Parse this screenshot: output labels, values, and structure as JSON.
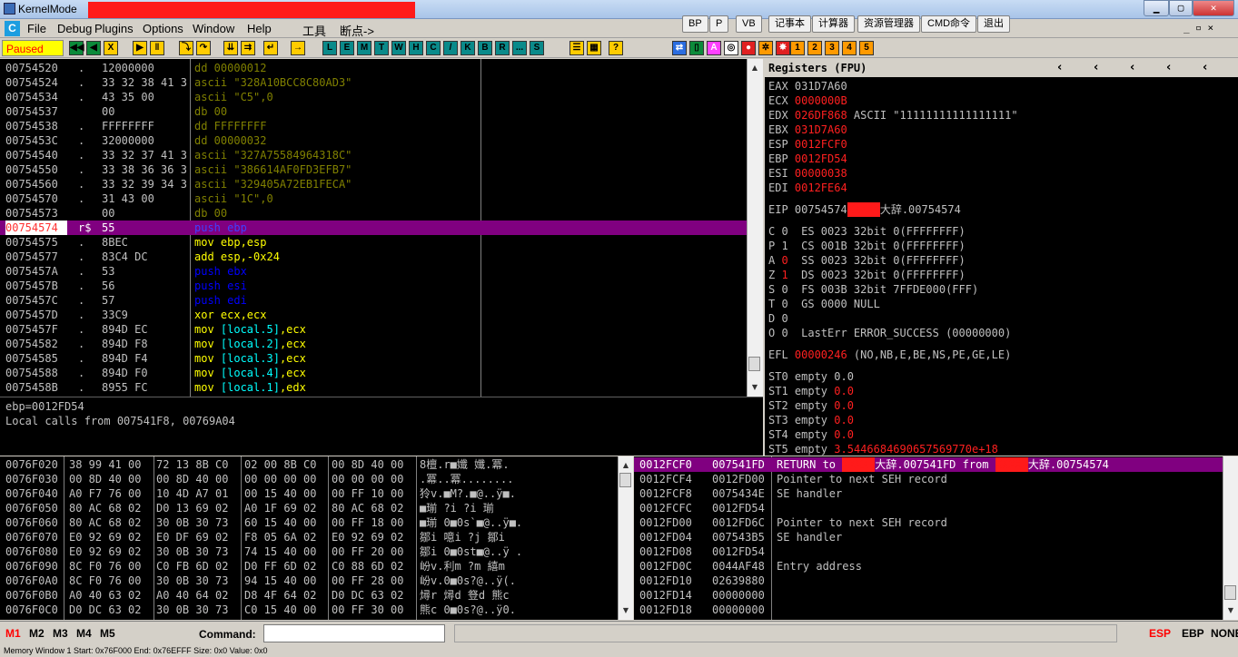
{
  "window": {
    "title": "KernelMode"
  },
  "menu": [
    "File",
    "Debug",
    "Plugins",
    "Options",
    "Window",
    "Help",
    "工具",
    "断点->"
  ],
  "tool_buttons": [
    "BP",
    "P",
    "VB",
    "记事本",
    "计算器",
    "资源管理器",
    "CMD命令",
    "退出"
  ],
  "status_flag": "Paused",
  "toolbar_letters": [
    "L",
    "E",
    "M",
    "T",
    "W",
    "H",
    "C",
    "/",
    "K",
    "B",
    "R",
    "...",
    "S"
  ],
  "toolbar_numbers": [
    "1",
    "2",
    "3",
    "4",
    "5"
  ],
  "cpu_rows": [
    {
      "addr": "00754520",
      "sym": ".",
      "hex": "12000000",
      "asm": "dd 00000012",
      "kind": "data"
    },
    {
      "addr": "00754524",
      "sym": ".",
      "hex": "33 32 38 41 3",
      "asm": "ascii \"328A10BCC8C80AD3\"",
      "kind": "data"
    },
    {
      "addr": "00754534",
      "sym": ".",
      "hex": "43 35 00",
      "asm": "ascii \"C5\",0",
      "kind": "data"
    },
    {
      "addr": "00754537",
      "sym": "",
      "hex": "00",
      "asm": "db 00",
      "kind": "data"
    },
    {
      "addr": "00754538",
      "sym": ".",
      "hex": "FFFFFFFF",
      "asm": "dd FFFFFFFF",
      "kind": "data"
    },
    {
      "addr": "0075453C",
      "sym": ".",
      "hex": "32000000",
      "asm": "dd 00000032",
      "kind": "data"
    },
    {
      "addr": "00754540",
      "sym": ".",
      "hex": "33 32 37 41 3",
      "asm": "ascii \"327A75584964318C\"",
      "kind": "data"
    },
    {
      "addr": "00754550",
      "sym": ".",
      "hex": "33 38 36 36 3",
      "asm": "ascii \"386614AF0FD3EFB7\"",
      "kind": "data"
    },
    {
      "addr": "00754560",
      "sym": ".",
      "hex": "33 32 39 34 3",
      "asm": "ascii \"329405A72EB1FECA\"",
      "kind": "data"
    },
    {
      "addr": "00754570",
      "sym": ".",
      "hex": "31 43 00",
      "asm": "ascii \"1C\",0",
      "kind": "data"
    },
    {
      "addr": "00754573",
      "sym": "",
      "hex": "00",
      "asm": "db 00",
      "kind": "data"
    },
    {
      "addr": "00754574",
      "sym": "r$",
      "hex": "55",
      "asm": "push ebp",
      "kind": "push",
      "sel": true
    },
    {
      "addr": "00754575",
      "sym": ".",
      "hex": "8BEC",
      "asm": "mov ebp,esp",
      "kind": "mov"
    },
    {
      "addr": "00754577",
      "sym": ".",
      "hex": "83C4 DC",
      "asm": "add esp,-0x24",
      "kind": "mov"
    },
    {
      "addr": "0075457A",
      "sym": ".",
      "hex": "53",
      "asm": "push ebx",
      "kind": "push"
    },
    {
      "addr": "0075457B",
      "sym": ".",
      "hex": "56",
      "asm": "push esi",
      "kind": "push"
    },
    {
      "addr": "0075457C",
      "sym": ".",
      "hex": "57",
      "asm": "push edi",
      "kind": "push"
    },
    {
      "addr": "0075457D",
      "sym": ".",
      "hex": "33C9",
      "asm": "xor ecx,ecx",
      "kind": "mov"
    },
    {
      "addr": "0075457F",
      "sym": ".",
      "hex": "894D EC",
      "asm": "mov [local.5],ecx",
      "kind": "mov"
    },
    {
      "addr": "00754582",
      "sym": ".",
      "hex": "894D F8",
      "asm": "mov [local.2],ecx",
      "kind": "mov"
    },
    {
      "addr": "00754585",
      "sym": ".",
      "hex": "894D F4",
      "asm": "mov [local.3],ecx",
      "kind": "mov"
    },
    {
      "addr": "00754588",
      "sym": ".",
      "hex": "894D F0",
      "asm": "mov [local.4],ecx",
      "kind": "mov"
    },
    {
      "addr": "0075458B",
      "sym": ".",
      "hex": "8955 FC",
      "asm": "mov [local.1],edx",
      "kind": "mov"
    }
  ],
  "info_lines": [
    "ebp=0012FD54",
    "Local calls from 007541F8, 00769A04"
  ],
  "registers": {
    "header": "Registers (FPU)",
    "gp": [
      {
        "name": "EAX",
        "val": "031D7A60",
        "red": false,
        "extra": ""
      },
      {
        "name": "ECX",
        "val": "0000000B",
        "red": true,
        "extra": ""
      },
      {
        "name": "EDX",
        "val": "026DF868",
        "red": true,
        "extra": "ASCII \"11111111111111111\""
      },
      {
        "name": "EBX",
        "val": "031D7A60",
        "red": true,
        "extra": ""
      },
      {
        "name": "ESP",
        "val": "0012FCF0",
        "red": true,
        "extra": ""
      },
      {
        "name": "EBP",
        "val": "0012FD54",
        "red": true,
        "extra": ""
      },
      {
        "name": "ESI",
        "val": "00000038",
        "red": true,
        "extra": ""
      },
      {
        "name": "EDI",
        "val": "0012FE64",
        "red": true,
        "extra": ""
      }
    ],
    "eip": {
      "name": "EIP",
      "val": "00754574",
      "suffix": "大辞.00754574"
    },
    "flags": [
      {
        "f": "C",
        "v": "0",
        "red": false,
        "seg": "ES 0023 32bit 0(FFFFFFFF)"
      },
      {
        "f": "P",
        "v": "1",
        "red": false,
        "seg": "CS 001B 32bit 0(FFFFFFFF)"
      },
      {
        "f": "A",
        "v": "0",
        "red": true,
        "seg": "SS 0023 32bit 0(FFFFFFFF)"
      },
      {
        "f": "Z",
        "v": "1",
        "red": true,
        "seg": "DS 0023 32bit 0(FFFFFFFF)"
      },
      {
        "f": "S",
        "v": "0",
        "red": false,
        "seg": "FS 003B 32bit 7FFDE000(FFF)"
      },
      {
        "f": "T",
        "v": "0",
        "red": false,
        "seg": "GS 0000 NULL"
      },
      {
        "f": "D",
        "v": "0",
        "red": false,
        "seg": ""
      },
      {
        "f": "O",
        "v": "0",
        "red": false,
        "seg": "LastErr ERROR_SUCCESS (00000000)"
      }
    ],
    "efl": {
      "name": "EFL",
      "val": "00000246",
      "desc": "(NO,NB,E,BE,NS,PE,GE,LE)"
    },
    "fpu": [
      {
        "name": "ST0",
        "state": "empty",
        "val": "0.0",
        "red": false
      },
      {
        "name": "ST1",
        "state": "empty",
        "val": "0.0",
        "red": true
      },
      {
        "name": "ST2",
        "state": "empty",
        "val": "0.0",
        "red": true
      },
      {
        "name": "ST3",
        "state": "empty",
        "val": "0.0",
        "red": true
      },
      {
        "name": "ST4",
        "state": "empty",
        "val": "0.0",
        "red": true
      },
      {
        "name": "ST5",
        "state": "empty",
        "val": "3.5446684690657569770e+18",
        "red": true
      }
    ]
  },
  "dump_rows": [
    {
      "addr": "0076F020",
      "h": [
        "38 99 41 00",
        "72 13 8B C0",
        "02 00 8B C0",
        "00 8D 40 00"
      ],
      "a": "8檀.r■孅 孅.冪."
    },
    {
      "addr": "0076F030",
      "h": [
        "00 8D 40 00",
        "00 8D 40 00",
        "00 00 00 00",
        "00 00 00 00"
      ],
      "a": ".冪..冪........"
    },
    {
      "addr": "0076F040",
      "h": [
        "A0 F7 76 00",
        "10 4D A7 01",
        "00 15 40 00",
        "00 FF 10 00"
      ],
      "a": "狑v.■M?.■@..ÿ■."
    },
    {
      "addr": "0076F050",
      "h": [
        "80 AC 68 02",
        "D0 13 69 02",
        "A0 1F 69 02",
        "80 AC 68 02"
      ],
      "a": "■瑐 ?i ?i 瑐"
    },
    {
      "addr": "0076F060",
      "h": [
        "80 AC 68 02",
        "30 0B 30 73",
        "60 15 40 00",
        "00 FF 18 00"
      ],
      "a": "■瑐 0■0s`■@..ÿ■."
    },
    {
      "addr": "0076F070",
      "h": [
        "E0 92 69 02",
        "E0 DF 69 02",
        "F8 05 6A 02",
        "E0 92 69 02"
      ],
      "a": "鄒i 噫i ?j 鄒i"
    },
    {
      "addr": "0076F080",
      "h": [
        "E0 92 69 02",
        "30 0B 30 73",
        "74 15 40 00",
        "00 FF 20 00"
      ],
      "a": "鄒i 0■0st■@..ÿ ."
    },
    {
      "addr": "0076F090",
      "h": [
        "8C F0 76 00",
        "C0 FB 6D 02",
        "D0 FF 6D 02",
        "C0 88 6D 02"
      ],
      "a": "岎v.利m ?m 繥m"
    },
    {
      "addr": "0076F0A0",
      "h": [
        "8C F0 76 00",
        "30 0B 30 73",
        "94 15 40 00",
        "00 FF 28 00"
      ],
      "a": "岎v.0■0s?@..ÿ(."
    },
    {
      "addr": "0076F0B0",
      "h": [
        "A0 40 63 02",
        "A0 40 64 02",
        "D8 4F 64 02",
        "D0 DC 63 02"
      ],
      "a": "燖r 燖d 豋d 熊c"
    },
    {
      "addr": "0076F0C0",
      "h": [
        "D0 DC 63 02",
        "30 0B 30 73",
        "C0 15 40 00",
        "00 FF 30 00"
      ],
      "a": "熊c 0■0s?@..ÿ0."
    }
  ],
  "stack_rows": [
    {
      "addr": "0012FCF0",
      "val": "007541FD",
      "pre": "RETURN to ",
      "mid": "大辞.007541FD from ",
      "post": "大辞.00754574",
      "sel": true
    },
    {
      "addr": "0012FCF4",
      "val": "0012FD00",
      "pre": "Pointer to next SEH record",
      "mid": "",
      "post": ""
    },
    {
      "addr": "0012FCF8",
      "val": "0075434E",
      "pre": "SE handler",
      "mid": "",
      "post": ""
    },
    {
      "addr": "0012FCFC",
      "val": "0012FD54",
      "pre": "",
      "mid": "",
      "post": ""
    },
    {
      "addr": "0012FD00",
      "val": "0012FD6C",
      "pre": "Pointer to next SEH record",
      "mid": "",
      "post": ""
    },
    {
      "addr": "0012FD04",
      "val": "007543B5",
      "pre": "SE handler",
      "mid": "",
      "post": ""
    },
    {
      "addr": "0012FD08",
      "val": "0012FD54",
      "pre": "",
      "mid": "",
      "post": ""
    },
    {
      "addr": "0012FD0C",
      "val": "0044AF48",
      "pre": "Entry address",
      "mid": "",
      "post": ""
    },
    {
      "addr": "0012FD10",
      "val": "02639880",
      "pre": "",
      "mid": "",
      "post": ""
    },
    {
      "addr": "0012FD14",
      "val": "00000000",
      "pre": "",
      "mid": "",
      "post": ""
    },
    {
      "addr": "0012FD18",
      "val": "00000000",
      "pre": "",
      "mid": "",
      "post": ""
    }
  ],
  "cmdbar": {
    "m_tabs": [
      "M1",
      "M2",
      "M3",
      "M4",
      "M5"
    ],
    "command_label": "Command:",
    "right": [
      "ESP",
      "EBP",
      "NONE"
    ]
  },
  "statusbar": "Memory Window 1  Start: 0x76F000  End: 0x76EFFF  Size: 0x0 Value: 0x0",
  "colors": {
    "selection": "#800080",
    "asm_data": "#808000",
    "asm_push": "#0000ff",
    "asm_mov": "#ffff00",
    "mem": "#00ffff",
    "red": "#ff2020"
  }
}
